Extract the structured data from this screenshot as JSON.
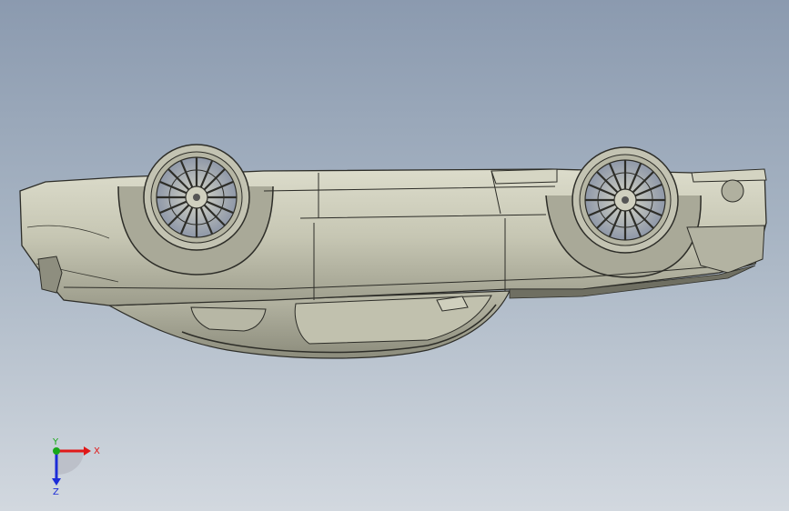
{
  "viewport": {
    "background_top": "#8b9aaf",
    "background_bottom": "#d2d8df"
  },
  "model": {
    "body_color": "#c9c9b6",
    "shadow_color": "#8d8d7d",
    "edge_color": "#2d2d28",
    "rim_color": "#9aa6b8",
    "tire_color": "#c3c3b2"
  },
  "triad": {
    "x_label": "X",
    "y_label": "Y",
    "z_label": "Z",
    "x_color": "#e01818",
    "y_color": "#18a818",
    "z_color": "#1c2cd8"
  }
}
